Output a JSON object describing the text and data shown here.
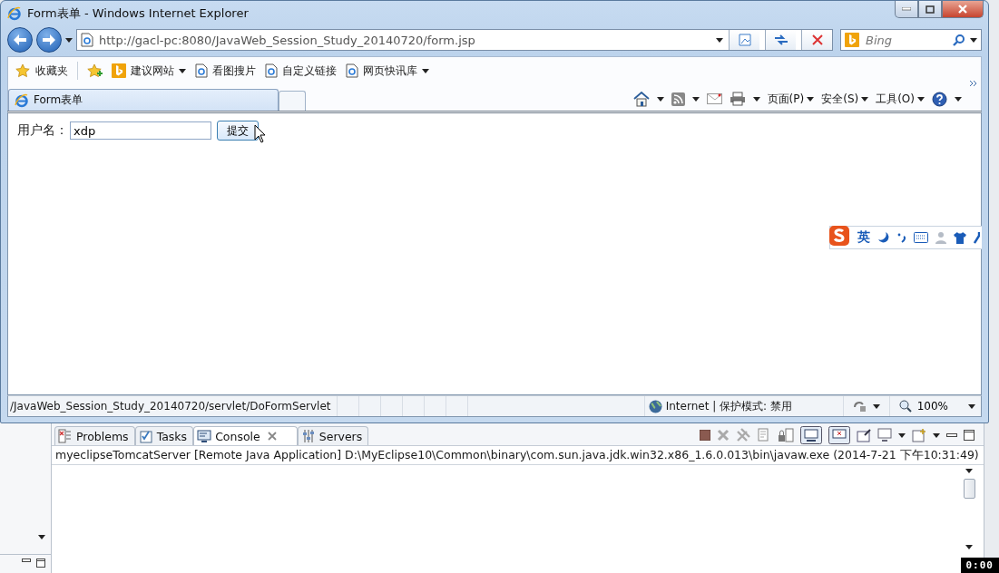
{
  "browser": {
    "title": "Form表单 - Windows Internet Explorer",
    "address": "http://gacl-pc:8080/JavaWeb_Session_Study_20140720/form.jsp",
    "search_placeholder": "Bing",
    "favorites": [
      {
        "kind": "star",
        "label": "收藏夹",
        "dropdown": false
      },
      {
        "kind": "bing",
        "label": "建议网站",
        "dropdown": true
      },
      {
        "kind": "page",
        "label": "看图搜片",
        "dropdown": false
      },
      {
        "kind": "page",
        "label": "自定义链接",
        "dropdown": false
      },
      {
        "kind": "page",
        "label": "网页快讯库",
        "dropdown": true
      }
    ],
    "tabs": [
      {
        "label": "Form表单",
        "selected": true
      }
    ],
    "commands": [
      "页面(P)",
      "安全(S)",
      "工具(O)"
    ],
    "form": {
      "label": "用户名：",
      "value": "xdp",
      "button": "提交"
    },
    "ime": {
      "label": "英"
    },
    "status": {
      "text": "/JavaWeb_Session_Study_20140720/servlet/DoFormServlet",
      "zone": "Internet | 保护模式: 禁用",
      "zoom": "100%"
    }
  },
  "console": {
    "tabs": [
      {
        "kind": "problems",
        "label": "Problems",
        "selected": false
      },
      {
        "kind": "tasks",
        "label": "Tasks",
        "selected": false
      },
      {
        "kind": "console",
        "label": "Console",
        "selected": true
      },
      {
        "kind": "servers",
        "label": "Servers",
        "selected": false
      }
    ],
    "header": "myeclipseTomcatServer [Remote Java Application] D:\\MyEclipse10\\Common\\binary\\com.sun.java.jdk.win32.x86_1.6.0.013\\bin\\javaw.exe (2014-7-21 下午10:31:49)"
  },
  "timestamp": "0:00"
}
